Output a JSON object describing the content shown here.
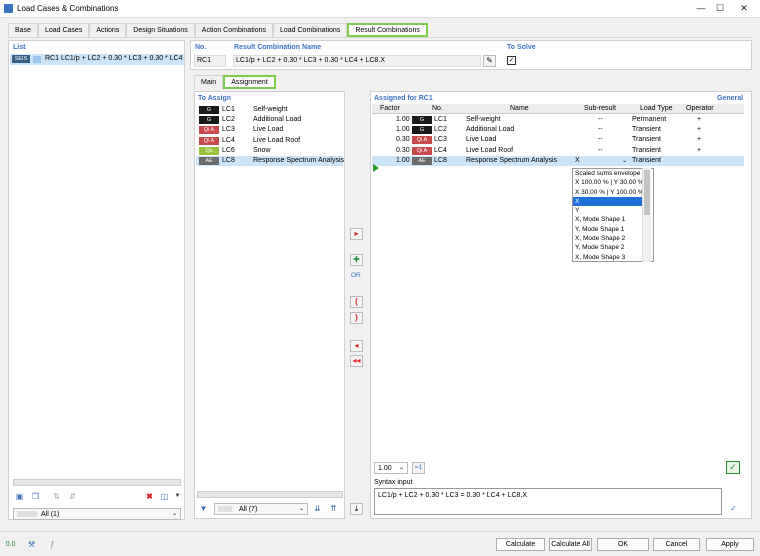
{
  "window": {
    "title": "Load Cases & Combinations",
    "minimize": "—",
    "maximize": "☐",
    "close": "✕"
  },
  "tabs": [
    "Base",
    "Load Cases",
    "Actions",
    "Design Situations",
    "Action Combinations",
    "Load Combinations",
    "Result Combinations"
  ],
  "list": {
    "header": "List",
    "item_badge": "SEIS",
    "item_text": "RC1  LC1/p + LC2 + 0.30 * LC3 + 0.30 * LC4 + LC8.X",
    "filter": "All (1)"
  },
  "no": {
    "label": "No.",
    "value": "RC1"
  },
  "rcname": {
    "label": "Result Combination Name",
    "value": "LC1/p + LC2 + 0.30 * LC3 + 0.30 * LC4 + LC8.X"
  },
  "tosolve": {
    "label": "To Solve"
  },
  "subtabs": [
    "Main",
    "Assignment"
  ],
  "toassign": {
    "header": "To Assign",
    "filter": "All (7)",
    "items": [
      {
        "badge": "G",
        "cls": "b-G",
        "lc": "LC1",
        "name": "Self-weight"
      },
      {
        "badge": "G",
        "cls": "b-G",
        "lc": "LC2",
        "name": "Additional Load"
      },
      {
        "badge": "Qi A",
        "cls": "b-QiA",
        "lc": "LC3",
        "name": "Live Load"
      },
      {
        "badge": "Qi A",
        "cls": "b-QiA",
        "lc": "LC4",
        "name": "Live Load Roof"
      },
      {
        "badge": "Qs",
        "cls": "b-Qs",
        "lc": "LC6",
        "name": "Snow"
      },
      {
        "badge": "AE",
        "cls": "b-AE",
        "lc": "LC8",
        "name": "Response Spectrum Analysis"
      }
    ]
  },
  "middle": {
    "or": "OR",
    "open": "(",
    "close": ")"
  },
  "assigned": {
    "header": "Assigned for RC1",
    "general": "General",
    "columns": [
      "Factor",
      "No.",
      "Name",
      "Sub-result",
      "Load Type",
      "Operator"
    ],
    "rows": [
      {
        "factor": "1.00",
        "badge": "G",
        "cls": "b-G",
        "lc": "LC1",
        "name": "Self-weight",
        "sub": "--",
        "type": "Permanent",
        "op": "+"
      },
      {
        "factor": "1.00",
        "badge": "G",
        "cls": "b-G",
        "lc": "LC2",
        "name": "Additional Load",
        "sub": "--",
        "type": "Transient",
        "op": "+"
      },
      {
        "factor": "0.30",
        "badge": "Qi A",
        "cls": "b-QiA",
        "lc": "LC3",
        "name": "Live Load",
        "sub": "--",
        "type": "Transient",
        "op": "+"
      },
      {
        "factor": "0.30",
        "badge": "Qi A",
        "cls": "b-QiA",
        "lc": "LC4",
        "name": "Live Load Roof",
        "sub": "--",
        "type": "Transient",
        "op": "+"
      },
      {
        "factor": "1.00",
        "badge": "AE",
        "cls": "b-AE",
        "lc": "LC8",
        "name": "Response Spectrum Analysis",
        "sub": "X",
        "type": "Transient",
        "op": ""
      }
    ],
    "dropdown": [
      "Scaled sums envelope",
      "X 100.00 % | Y 30.00 %",
      "X 30.00 % | Y 100.00 %",
      "X",
      "Y",
      "X, Mode Shape 1",
      "Y, Mode Shape 1",
      "X, Mode Shape 2",
      "Y, Mode Shape 2",
      "X, Mode Shape 3"
    ],
    "dropdown_selected": 3,
    "factor_select": "1.00",
    "factor_btn": "=1"
  },
  "syntax": {
    "label": "Syntax input",
    "value": "LC1/p + LC2 + 0.30 * LC3 = 0.30 * LC4 + LC8.X"
  },
  "footer": {
    "calculate": "Calculate",
    "calculate_all": "Calculate All",
    "ok": "OK",
    "cancel": "Cancel",
    "apply": "Apply"
  },
  "colors": {
    "accent": "#3a73c4",
    "tab_highlight": "#7dcc4a",
    "selection": "#cce4f7"
  }
}
